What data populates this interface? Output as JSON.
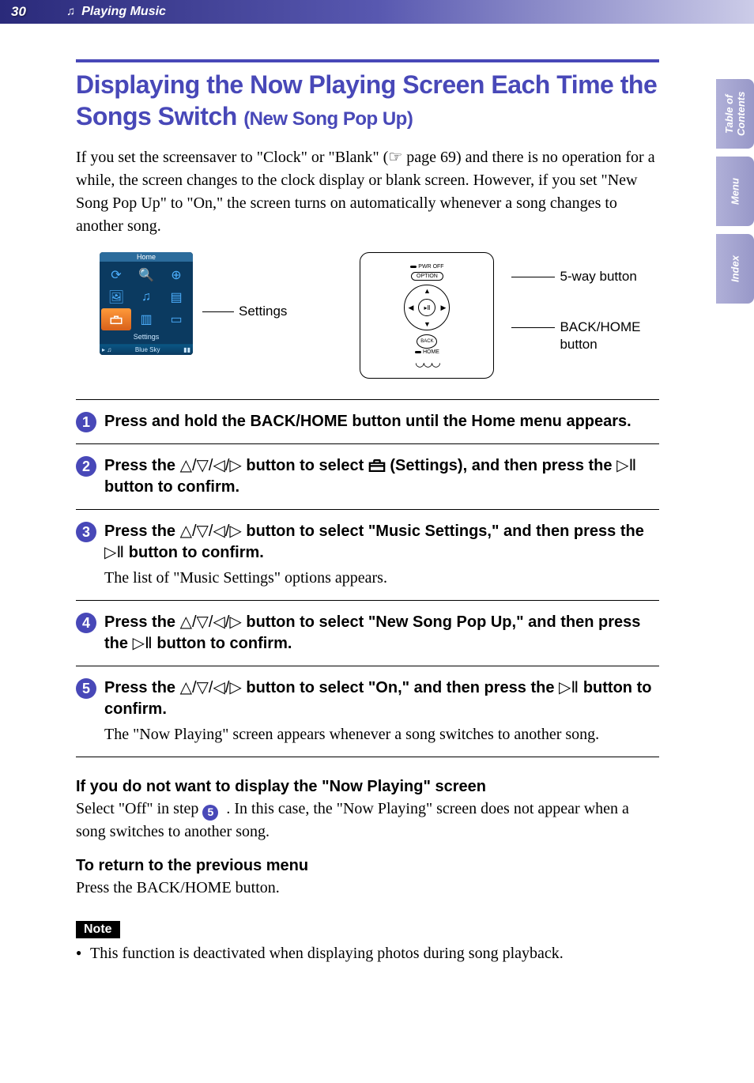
{
  "header": {
    "page_number": "30",
    "section": "Playing Music"
  },
  "side_tabs": {
    "toc": "Table of\nContents",
    "menu": "Menu",
    "index": "Index"
  },
  "title": {
    "main": "Displaying the Now Playing Screen Each Time the Songs Switch ",
    "sub": "(New Song Pop Up)"
  },
  "intro": "If you set the screensaver to \"Clock\" or \"Blank\" (☞ page 69) and there is no operation for a while, the screen changes to the clock display or blank screen. However, if you set \"New Song Pop Up\" to \"On,\" the screen turns on automatically whenever a song changes to another song.",
  "illus": {
    "device_top": "Home",
    "device_label": "Settings",
    "device_np": "Blue Sky",
    "settings_callout": "Settings",
    "pwr": "PWR OFF",
    "option": "OPTION",
    "back": "BACK",
    "home": "HOME",
    "five_way": "5-way button",
    "back_home": "BACK/HOME\nbutton"
  },
  "steps": [
    {
      "n": "1",
      "title": "Press and hold the BACK/HOME button until the Home menu appears.",
      "desc": ""
    },
    {
      "n": "2",
      "title_pre": "Press the ",
      "nav": "△/▽/◁/▷",
      "title_mid": " button to select ",
      "title_post": " (Settings), and then press the ",
      "play": "▷Ⅱ",
      "title_end": " button to confirm.",
      "desc": ""
    },
    {
      "n": "3",
      "title_pre": "Press the ",
      "nav": "△/▽/◁/▷",
      "title_post": " button to select \"Music Settings,\" and then press the ",
      "play": "▷Ⅱ",
      "title_end": " button to confirm.",
      "desc": "The list of \"Music Settings\" options appears."
    },
    {
      "n": "4",
      "title_pre": "Press the ",
      "nav": "△/▽/◁/▷",
      "title_post": " button to select \"New Song Pop Up,\" and then press the ",
      "play": "▷Ⅱ",
      "title_end": " button to confirm.",
      "desc": ""
    },
    {
      "n": "5",
      "title_pre": "Press the ",
      "nav": "△/▽/◁/▷",
      "title_post": " button to select \"On,\" and then press the ",
      "play": "▷Ⅱ",
      "title_end": " button to confirm.",
      "desc": "The \"Now Playing\" screen appears whenever a song switches to another song."
    }
  ],
  "sub1": {
    "head": "If you do not want to display the \"Now Playing\" screen",
    "body_pre": "Select \"Off\" in step ",
    "step_ref": "5",
    "body_post": ". In this case, the \"Now Playing\" screen does not appear when a song switches to another song."
  },
  "sub2": {
    "head": "To return to the previous menu",
    "body": "Press the BACK/HOME button."
  },
  "note": {
    "label": "Note",
    "item": "This function is deactivated when displaying photos during song playback."
  }
}
